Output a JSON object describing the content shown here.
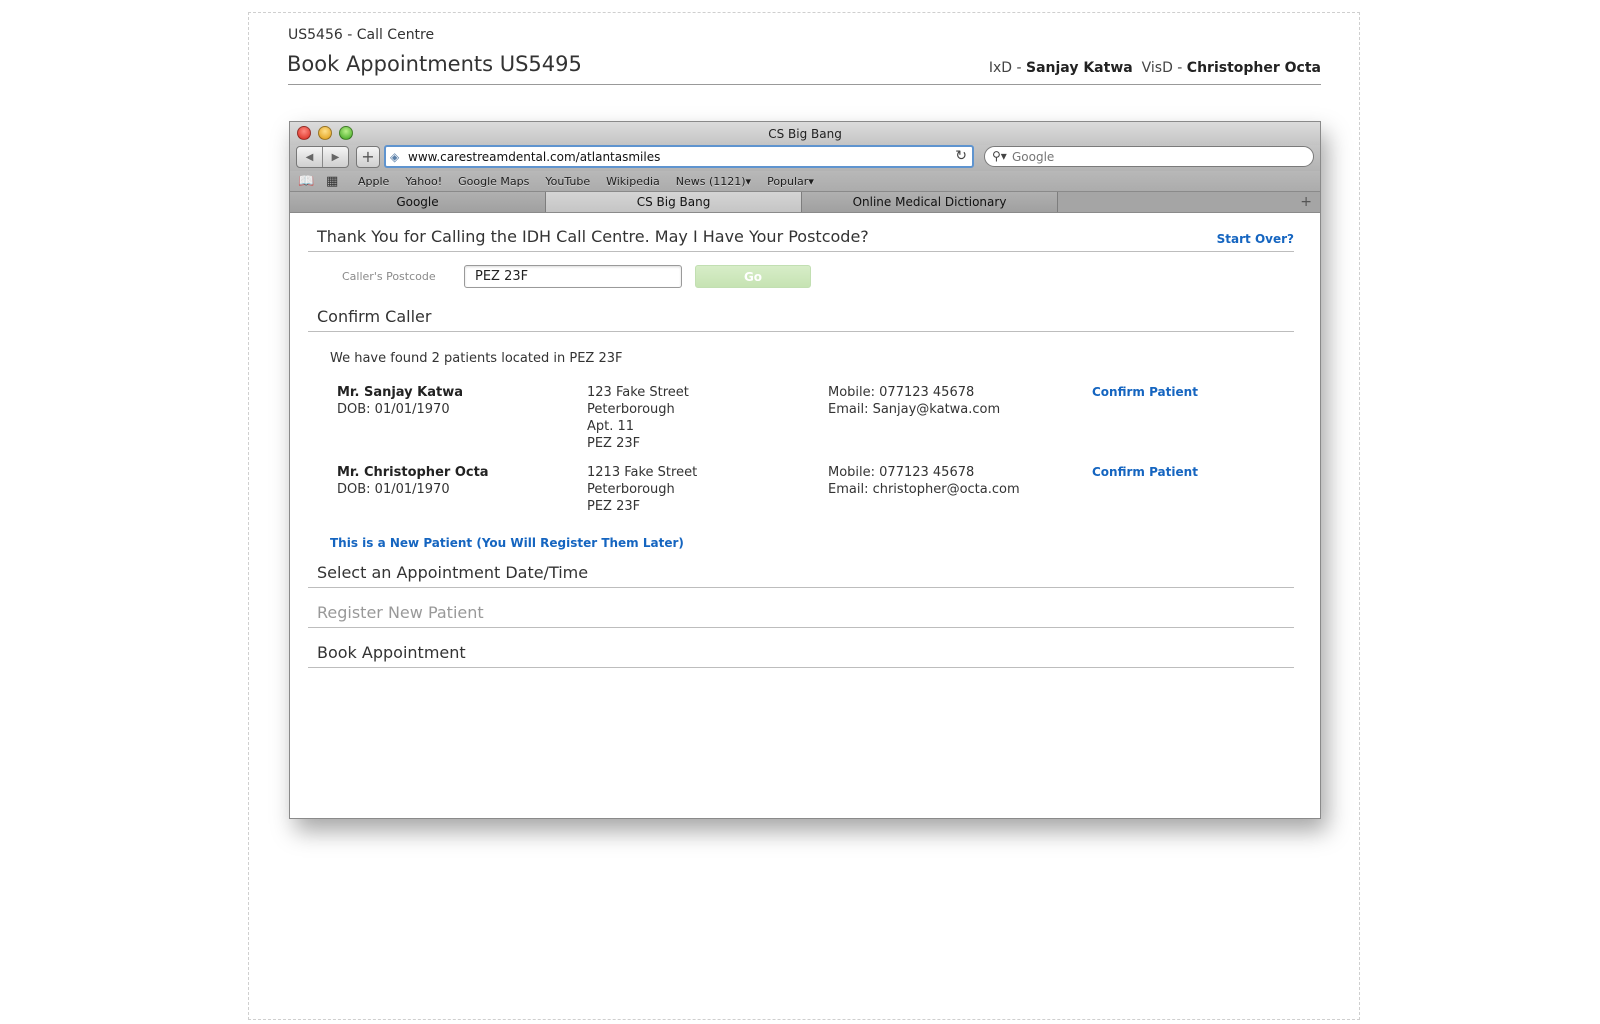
{
  "doc": {
    "subtitle": "US5456 - Call Centre",
    "title": "Book Appointments US5495",
    "ixd_label": "IxD - ",
    "ixd_name": "Sanjay Katwa",
    "visd_label": "VisD - ",
    "visd_name": "Christopher Octa"
  },
  "browser": {
    "window_title": "CS Big Bang",
    "url": "www.carestreamdental.com/atlantasmiles",
    "search_placeholder": "Google",
    "icons": {
      "back": "back-arrow-icon",
      "forward": "forward-arrow-icon",
      "add": "plus-icon",
      "site": "site-favicon-icon",
      "reload": "reload-icon",
      "search": "magnifier-icon",
      "bookmarks": "open-book-icon",
      "top_sites": "grid-icon",
      "new_tab": "plus-icon"
    },
    "bookmarks": [
      "Apple",
      "Yahoo!",
      "Google Maps",
      "YouTube",
      "Wikipedia",
      "News (1121)▾",
      "Popular▾"
    ],
    "tabs": [
      {
        "label": "Google",
        "active": false
      },
      {
        "label": "CS Big Bang",
        "active": true
      },
      {
        "label": "Online Medical Dictionary",
        "active": false
      }
    ]
  },
  "page": {
    "postcode_section": {
      "heading": "Thank You for Calling the IDH Call Centre. May I Have Your Postcode?",
      "start_over": "Start Over?",
      "postcode_label": "Caller's Postcode",
      "postcode_value": "PEZ 23F",
      "go_label": "Go"
    },
    "confirm_section": {
      "heading": "Confirm Caller",
      "found_text": "We have found 2 patients located in PEZ 23F",
      "patients": [
        {
          "name": "Mr. Sanjay Katwa",
          "dob": "DOB: 01/01/1970",
          "address": [
            "123 Fake Street",
            "Peterborough",
            "Apt. 11",
            "PEZ 23F"
          ],
          "mobile": "Mobile: 077123 45678",
          "email": "Email: Sanjay@katwa.com",
          "confirm_label": "Confirm Patient"
        },
        {
          "name": "Mr. Christopher Octa",
          "dob": "DOB: 01/01/1970",
          "address": [
            "1213 Fake Street",
            "Peterborough",
            "PEZ 23F"
          ],
          "mobile": "Mobile: 077123 45678",
          "email": "Email: christopher@octa.com",
          "confirm_label": "Confirm Patient"
        }
      ],
      "new_patient_link": "This is a New Patient (You Will Register Them Later)"
    },
    "appointment_section": {
      "heading": "Select an Appointment Date/Time"
    },
    "register_section": {
      "heading": "Register New Patient"
    },
    "book_section": {
      "heading": "Book Appointment"
    }
  }
}
